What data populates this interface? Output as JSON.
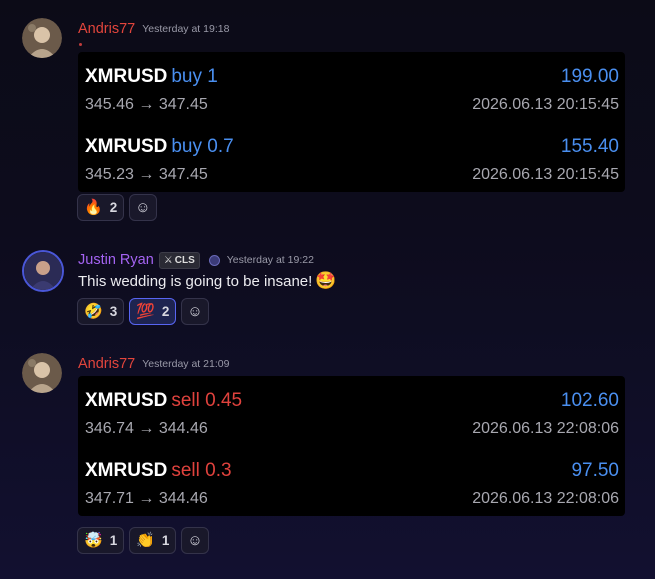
{
  "messages": [
    {
      "author": "Andris77",
      "time": "Yesterday at 19:18",
      "trades": [
        {
          "pair": "XMRUSD",
          "side": "buy 1",
          "range": "345.46 → 347.45",
          "pnl": "199.00",
          "date": "2026.06.13 20:15:45"
        },
        {
          "pair": "XMRUSD",
          "side": "buy 0.7",
          "range": "345.23 → 347.45",
          "pnl": "155.40",
          "date": "2026.06.13 20:15:45"
        }
      ],
      "reactions": [
        {
          "emoji": "🔥",
          "count": "2"
        }
      ]
    },
    {
      "author": "Justin Ryan",
      "tag": "CLS",
      "time": "Yesterday at 19:22",
      "text": "This wedding is going to be insane!",
      "text_emoji": "🤩",
      "reactions": [
        {
          "emoji": "🤣",
          "count": "3"
        },
        {
          "emoji": "💯",
          "count": "2"
        }
      ]
    },
    {
      "author": "Andris77",
      "time": "Yesterday at 21:09",
      "trades": [
        {
          "pair": "XMRUSD",
          "side": "sell 0.45",
          "range": "346.74 → 344.46",
          "pnl": "102.60",
          "date": "2026.06.13 22:08:06"
        },
        {
          "pair": "XMRUSD",
          "side": "sell 0.3",
          "range": "347.71 → 344.46",
          "pnl": "97.50",
          "date": "2026.06.13 22:08:06"
        }
      ],
      "reactions": [
        {
          "emoji": "🤯",
          "count": "1"
        },
        {
          "emoji": "👏",
          "count": "1"
        }
      ]
    }
  ],
  "add_reaction_icon": "☺",
  "colors": {
    "buy": "#4a8ff0",
    "sell": "#e0423d",
    "pnl": "#4a8ff0",
    "andris_name": "#e2453c",
    "justin_name": "#a463f2"
  }
}
